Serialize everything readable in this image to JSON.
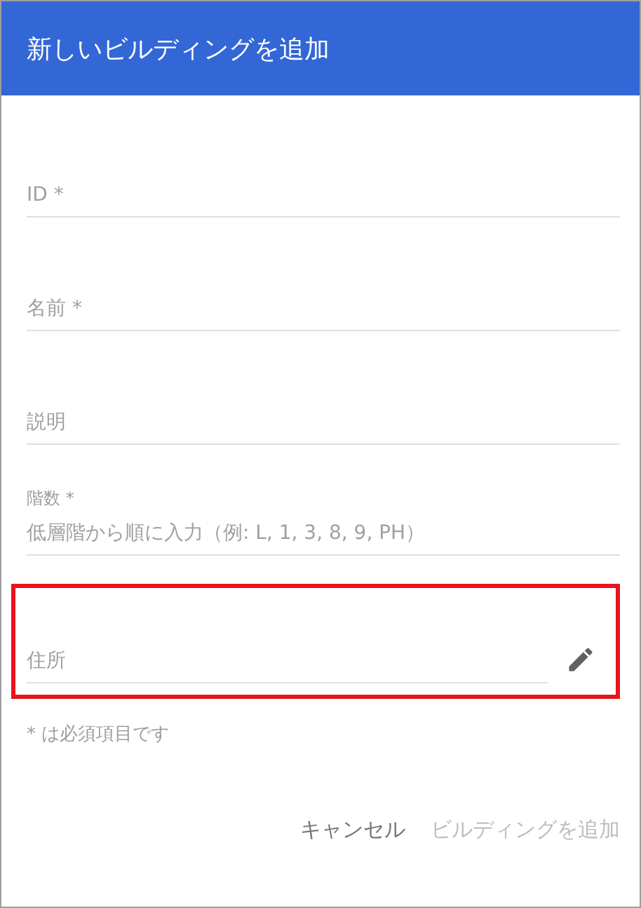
{
  "dialog": {
    "title": "新しいビルディングを追加"
  },
  "fields": [
    {
      "kind": "plain",
      "placeholder": "ID *",
      "highlighted": false
    },
    {
      "kind": "plain",
      "placeholder": "名前 *",
      "highlighted": false
    },
    {
      "kind": "plain",
      "placeholder": "説明",
      "highlighted": false
    },
    {
      "kind": "labeled",
      "label": "階数 *",
      "placeholder": "低層階から順に入力（例: L, 1, 3, 8, 9, PH）",
      "highlighted": false
    },
    {
      "kind": "editable",
      "placeholder": "住所",
      "highlighted": true
    }
  ],
  "note": "* は必須項目です",
  "buttons": [
    {
      "label": "キャンセル",
      "disabled": false
    },
    {
      "label": "ビルディングを追加",
      "disabled": true
    }
  ]
}
